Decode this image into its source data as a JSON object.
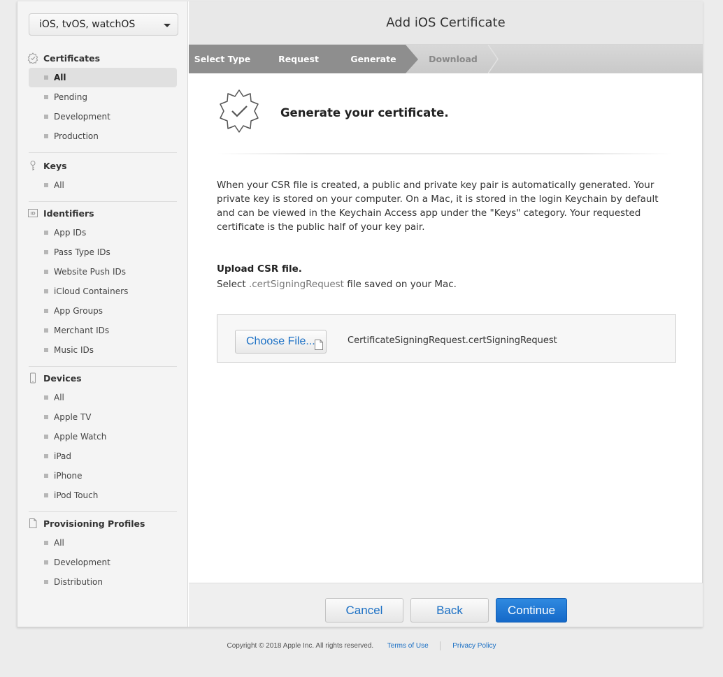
{
  "sidebar": {
    "platform": "iOS, tvOS, watchOS",
    "sections": {
      "certificates": {
        "title": "Certificates",
        "items": [
          "All",
          "Pending",
          "Development",
          "Production"
        ]
      },
      "keys": {
        "title": "Keys",
        "items": [
          "All"
        ]
      },
      "identifiers": {
        "title": "Identifiers",
        "items": [
          "App IDs",
          "Pass Type IDs",
          "Website Push IDs",
          "iCloud Containers",
          "App Groups",
          "Merchant IDs",
          "Music IDs"
        ]
      },
      "devices": {
        "title": "Devices",
        "items": [
          "All",
          "Apple TV",
          "Apple Watch",
          "iPad",
          "iPhone",
          "iPod Touch"
        ]
      },
      "profiles": {
        "title": "Provisioning Profiles",
        "items": [
          "All",
          "Development",
          "Distribution"
        ]
      }
    },
    "active_item": "certificates.All"
  },
  "main": {
    "title": "Add iOS Certificate",
    "steps": [
      "Select Type",
      "Request",
      "Generate",
      "Download"
    ],
    "current_step": "Generate",
    "heading": "Generate your certificate.",
    "description": "When your CSR file is created, a public and private key pair is automatically generated. Your private key is stored on your computer. On a Mac, it is stored in the login Keychain by default and can be viewed in the Keychain Access app under the \"Keys\" category. Your requested certificate is the public half of your key pair.",
    "upload_title": "Upload CSR file.",
    "upload_sub_prefix": "Select ",
    "upload_sub_ext": ".certSigningRequest",
    "upload_sub_suffix": " file saved on your Mac.",
    "choose_file_label": "Choose File...",
    "file_name": "CertificateSigningRequest.certSigningRequest"
  },
  "buttons": {
    "cancel": "Cancel",
    "back": "Back",
    "continue": "Continue"
  },
  "footer": {
    "copyright": "Copyright © 2018 Apple Inc. All rights reserved.",
    "terms": "Terms of Use",
    "privacy": "Privacy Policy"
  },
  "colors": {
    "accent": "#1a6fc4",
    "primary_button": "#1a74d4",
    "step_done": "#8e8e8e"
  }
}
